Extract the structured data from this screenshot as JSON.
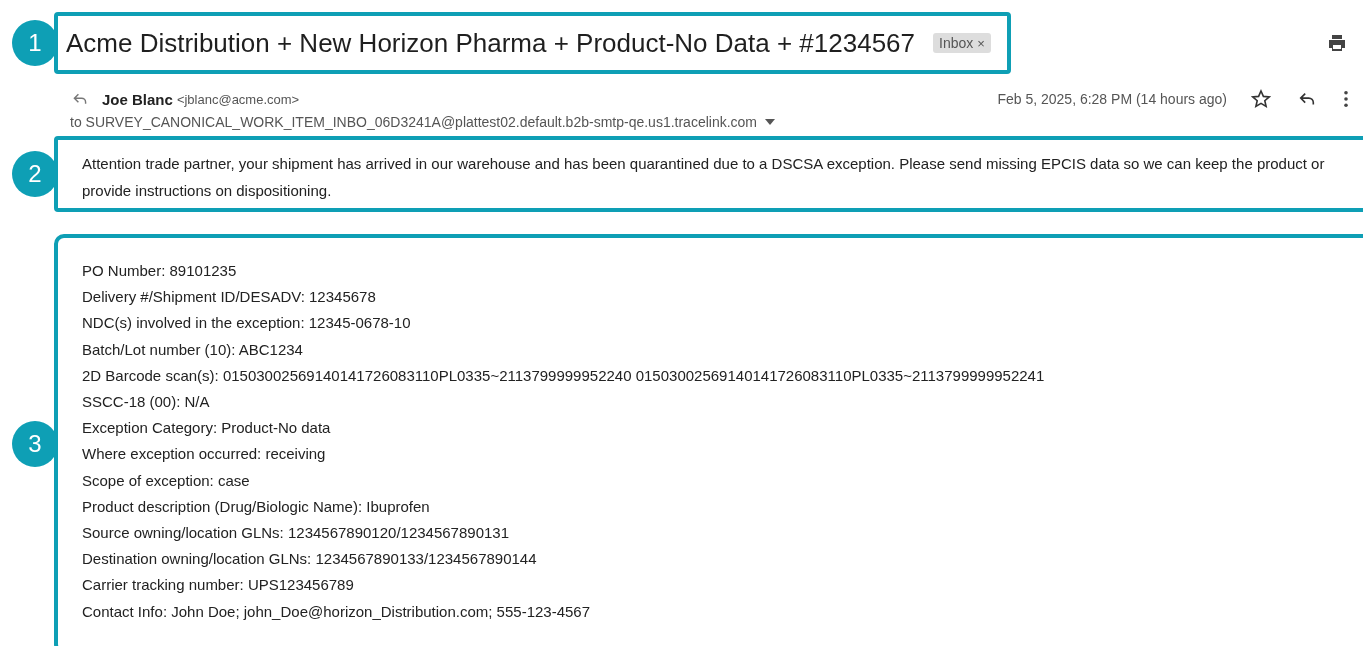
{
  "callouts": [
    "1",
    "2",
    "3"
  ],
  "subject": {
    "title": "Acme Distribution + New Horizon Pharma + Product-No Data + #1234567",
    "label": "Inbox",
    "label_close": "×"
  },
  "sender": {
    "name": "Joe Blanc",
    "email": "<jblanc@acme.com>",
    "to": "to SURVEY_CANONICAL_WORK_ITEM_INBO_06D3241A@plattest02.default.b2b-smtp-qe.us1.tracelink.com",
    "date": "Feb 5, 2025, 6:28 PM (14 hours ago)",
    "starred": false
  },
  "intro": "Attention trade partner, your shipment has arrived in our warehouse and has been quarantined due to a DSCSA exception. Please send missing EPCIS data so we can keep the product or provide instructions on dispositioning.",
  "details": [
    "PO Number: 89101235",
    "Delivery #/Shipment ID/DESADV: 12345678",
    "NDC(s) involved in the exception: 12345-0678-10",
    "Batch/Lot number (10): ABC1234",
    "2D Barcode scan(s): 01503002569140141726083110PL0335~2113799999952240 01503002569140141726083110PL0335~2113799999952241",
    "SSCC-18 (00): N/A",
    "Exception Category: Product-No data",
    "Where exception occurred: receiving",
    "Scope of exception: case",
    "Product description (Drug/Biologic Name): Ibuprofen",
    "Source owning/location GLNs: 1234567890120/1234567890131",
    "Destination owning/location GLNs: 1234567890133/1234567890144",
    "Carrier tracking number: UPS123456789",
    "Contact Info: John Doe; john_Doe@horizon_Distribution.com; 555-123-4567"
  ]
}
